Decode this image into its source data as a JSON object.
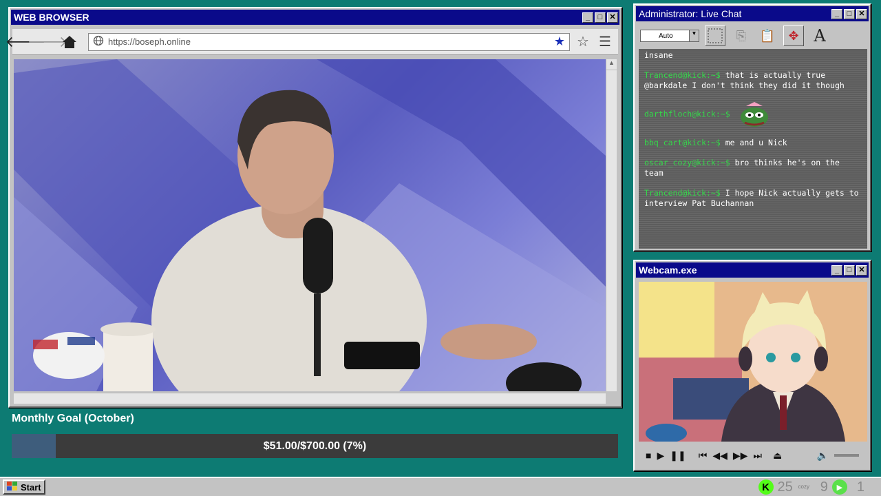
{
  "browser": {
    "title": "WEB BROWSER",
    "url": "https://boseph.online"
  },
  "chat": {
    "title": "Administrator: Live Chat",
    "font_select": "Auto",
    "text_tool": "A",
    "messages": [
      {
        "user": "",
        "text": "insane"
      },
      {
        "user": "Trancend@kick:~$",
        "text": "that is actually true @barkdale I don't think they did it though"
      },
      {
        "user": "darthfloch@kick:~$",
        "text": "",
        "emote": "pepe-emote"
      },
      {
        "user": "bbq_cart@kick:~$",
        "text": "me and u Nick"
      },
      {
        "user": "oscar_cozy@kick:~$",
        "text": "bro thinks he's on the team"
      },
      {
        "user": "Trancend@kick:~$",
        "text": "I hope Nick actually gets to interview Pat Buchannan"
      }
    ]
  },
  "webcam": {
    "title": "Webcam.exe"
  },
  "goal": {
    "title": "Monthly Goal (October)",
    "text": "$51.00/$700.00 (7%)",
    "progress_fraction": 0.073
  },
  "taskbar": {
    "start_label": "Start",
    "tray_count_a": "25",
    "tray_cozy": "cozy",
    "tray_count_b": "9",
    "tray_count_c": "1"
  },
  "colors": {
    "desktop": "#0d7b73",
    "titlebar": "#0a0a8a",
    "chat_user": "#34d94a",
    "goal_fill": "#3e5d7c",
    "kick": "#53fc18"
  }
}
